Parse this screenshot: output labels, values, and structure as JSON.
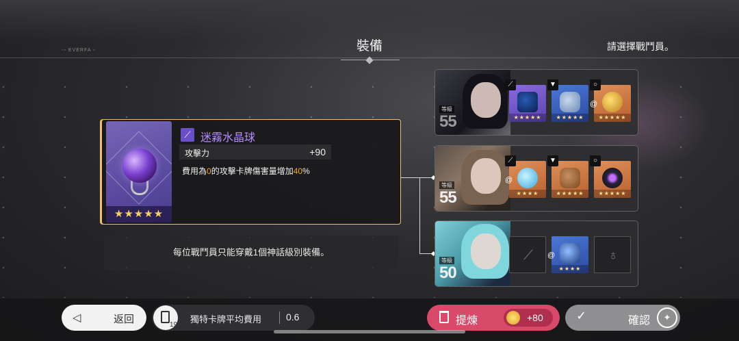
{
  "header": {
    "title": "裝備",
    "hint": "請選擇戰鬥員。",
    "deco": "EVERFA"
  },
  "item": {
    "name": "迷霧水晶球",
    "stars": "★★★★★",
    "stat_label": "攻擊力",
    "stat_value": "+90",
    "desc_prefix": "費用為",
    "desc_hl1": "0",
    "desc_mid": "的攻擊卡牌傷害量增加",
    "desc_hl2": "40",
    "desc_suffix": "%"
  },
  "notice": "每位戰鬥員只能穿戴1個神話級別裝備。",
  "members": [
    {
      "level_label": "等級",
      "level": "55",
      "slots": [
        {
          "type": "weapon",
          "stars": "★★★★★",
          "color": "#7a5ad8"
        },
        {
          "type": "armor",
          "stars": "★★★★★",
          "color": "#3c5fc0"
        },
        {
          "type": "accessory",
          "stars": "★★★★★",
          "color": "#cc7744"
        }
      ]
    },
    {
      "level_label": "等級",
      "level": "55",
      "slots": [
        {
          "type": "weapon",
          "stars": "★★★★",
          "color": "#cc7744"
        },
        {
          "type": "armor",
          "stars": "★★★★★",
          "color": "#cc7744"
        },
        {
          "type": "accessory",
          "stars": "★★★★★",
          "color": "#cc7744"
        }
      ]
    },
    {
      "level_label": "等級",
      "level": "50",
      "slots": [
        {
          "type": "weapon",
          "stars": "",
          "color": "#232325"
        },
        {
          "type": "armor",
          "stars": "★★★★",
          "color": "#3c5fc0"
        },
        {
          "type": "accessory",
          "stars": "",
          "color": "#232325"
        }
      ]
    }
  ],
  "bottom": {
    "back_label": "返回",
    "deck_count": "19",
    "cost_label": "獨特卡牌平均費用",
    "cost_value": "0.6",
    "refine_label": "提煉",
    "refine_reward": "+80",
    "confirm_label": "確認"
  },
  "colors": {
    "accent_gold": "#f0c070",
    "item_name": "#b68cff",
    "highlight": "#f5a623",
    "refine": "#d94a6a",
    "confirm": "#8f8f92"
  }
}
